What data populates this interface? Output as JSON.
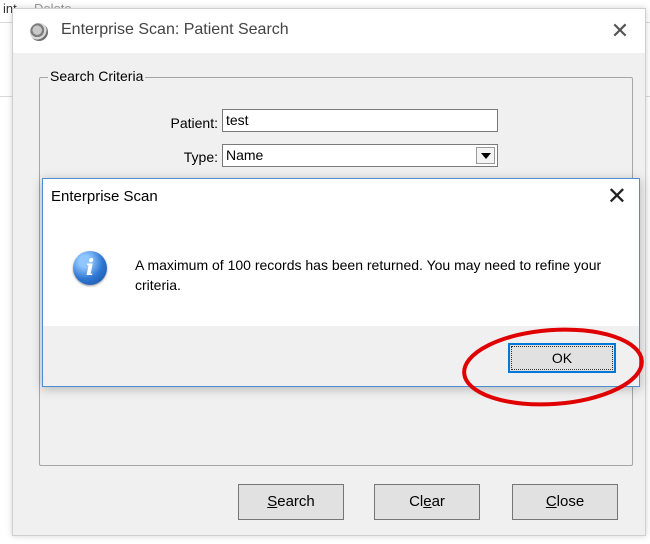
{
  "background": {
    "partial_text": "int",
    "delete_label": "Delete"
  },
  "dialog": {
    "title": "Enterprise Scan: Patient Search",
    "close_glyph": "✕",
    "group_legend": "Search Criteria",
    "patient_label": "Patient:",
    "patient_value": "test",
    "type_label": "Type:",
    "type_value": "Name",
    "buttons": {
      "search": {
        "underlined": "S",
        "rest": "earch"
      },
      "clear": {
        "before": "Cl",
        "underlined": "e",
        "after": "ar"
      },
      "close": {
        "underlined": "C",
        "rest": "lose"
      }
    }
  },
  "message_box": {
    "title": "Enterprise Scan",
    "close_glyph": "✕",
    "icon": "info-icon",
    "icon_glyph": "i",
    "message": "A maximum of 100 records has been returned. You may need to refine your criteria.",
    "ok_label": "OK"
  },
  "annotation": {
    "shape": "ellipse",
    "color": "#e00000"
  }
}
